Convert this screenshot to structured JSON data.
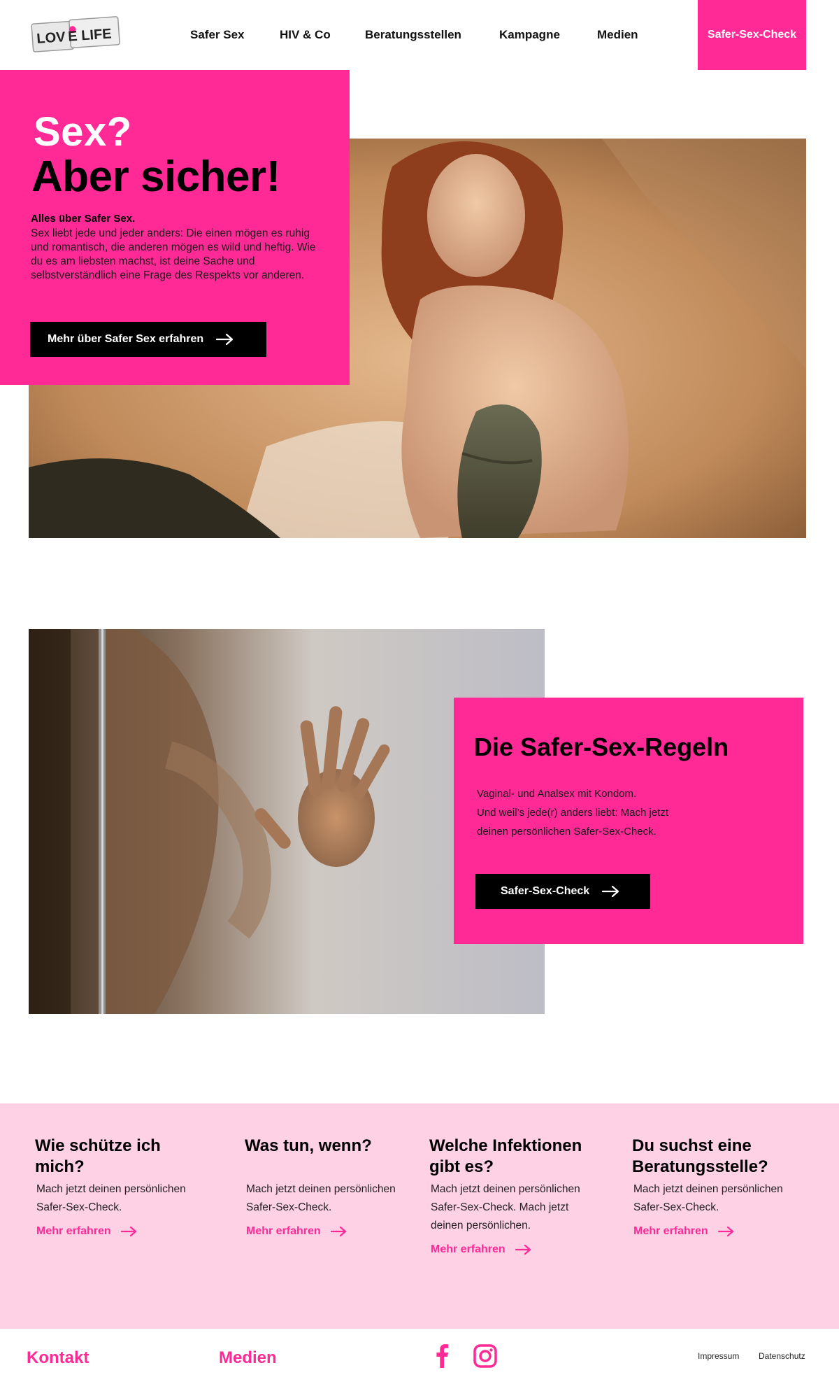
{
  "header": {
    "logo_text": "LOVE LIFE",
    "nav": [
      "Safer Sex",
      "HIV & Co",
      "Beratungsstellen",
      "Kampagne",
      "Medien"
    ],
    "cta": "Safer-Sex-Check"
  },
  "hero": {
    "title_line1": "Sex?",
    "title_line2": "Aber sicher!",
    "subtitle": "Alles über Safer Sex.",
    "text": "Sex liebt jede und jeder anders: Die einen mögen es ruhig und romantisch, die anderen mögen es wild und heftig. Wie du es am liebsten machst, ist deine Sache und selbstverständlich eine Frage des Respekts vor anderen.",
    "button": "Mehr über Safer Sex erfahren"
  },
  "rules": {
    "title": "Die Safer-Sex-Regeln",
    "line1": "Vaginal- und Analsex mit Kondom.",
    "line2": "Und weil’s jede(r) anders liebt: Mach jetzt deinen persönlichen Safer-Sex-Check.",
    "button": "Safer-Sex-Check"
  },
  "info": [
    {
      "heading": "Wie schütze ich mich?",
      "text": "Mach jetzt deinen persönlichen Safer-Sex-Check.",
      "link": "Mehr erfahren"
    },
    {
      "heading": "Was tun, wenn?",
      "text": "Mach jetzt deinen persönlichen Safer-Sex-Check.",
      "link": "Mehr erfahren"
    },
    {
      "heading": "Welche Infektionen gibt es?",
      "text": "Mach jetzt deinen persönlichen Safer-Sex-Check. Mach jetzt deinen persönlichen.",
      "link": "Mehr erfahren"
    },
    {
      "heading": "Du suchst eine Beratungsstelle?",
      "text": "Mach jetzt deinen persönlichen Safer-Sex-Check.",
      "link": "Mehr erfahren"
    }
  ],
  "footer": {
    "kontakt": "Kontakt",
    "medien": "Medien",
    "impressum": "Impressum",
    "datenschutz": "Datenschutz",
    "social_icons": [
      "facebook-icon",
      "instagram-icon"
    ]
  },
  "colors": {
    "accent": "#ff2a96",
    "light_pink": "#ffd1e5",
    "black": "#000000"
  }
}
